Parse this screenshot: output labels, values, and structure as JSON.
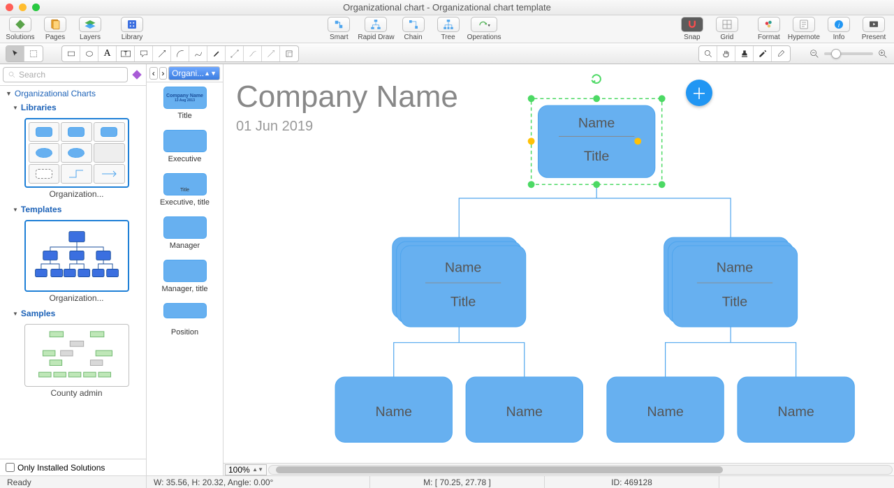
{
  "window": {
    "title": "Organizational chart - Organizational chart template"
  },
  "toolbar_main": {
    "solutions": "Solutions",
    "pages": "Pages",
    "layers": "Layers",
    "library": "Library",
    "smart": "Smart",
    "rapid_draw": "Rapid Draw",
    "chain": "Chain",
    "tree": "Tree",
    "operations": "Operations",
    "snap": "Snap",
    "grid": "Grid",
    "format": "Format",
    "hypernote": "Hypernote",
    "info": "Info",
    "present": "Present"
  },
  "search": {
    "placeholder": "Search"
  },
  "left_tree": {
    "root": "Organizational Charts",
    "libraries": "Libraries",
    "libraries_thumb": "Organization...",
    "templates": "Templates",
    "templates_thumb": "Organization...",
    "samples": "Samples",
    "samples_thumb": "County admin"
  },
  "only_installed": "Only Installed Solutions",
  "shape_panel": {
    "selector": "Organi...",
    "header_company": "Company Name",
    "header_date": "13 Aug 2013",
    "items": [
      "Title",
      "Executive",
      "Executive, title",
      "Manager",
      "Manager, title",
      "Position"
    ]
  },
  "canvas": {
    "company": "Company Name",
    "date": "01 Jun 2019",
    "top_name": "Name",
    "top_title": "Title",
    "mid_name": "Name",
    "mid_title": "Title",
    "leaf": "Name"
  },
  "bottom": {
    "zoom": "100%"
  },
  "status": {
    "ready": "Ready",
    "wh": "W: 35.56,  H: 20.32,  Angle: 0.00°",
    "m": "M: [ 70.25, 27.78 ]",
    "id": "ID: 469128"
  }
}
